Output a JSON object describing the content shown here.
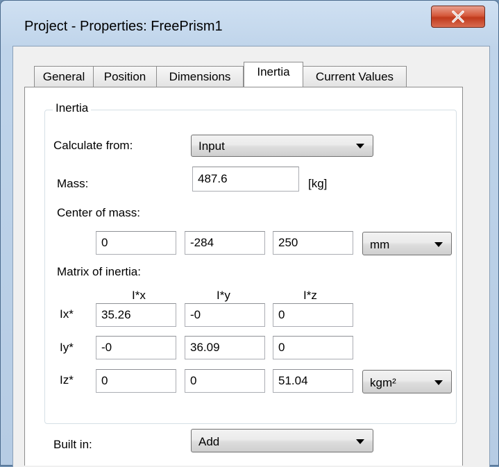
{
  "window": {
    "title": "Project - Properties: FreePrism1",
    "close_icon": "close-x-icon",
    "close_color": "#c7432a"
  },
  "tabs": [
    {
      "label": "General",
      "active": false
    },
    {
      "label": "Position",
      "active": false
    },
    {
      "label": "Dimensions",
      "active": false
    },
    {
      "label": "Inertia",
      "active": true
    },
    {
      "label": "Current Values",
      "active": false
    }
  ],
  "inertia": {
    "group_title": "Inertia",
    "calculate_from": {
      "label": "Calculate from:",
      "value": "Input"
    },
    "mass": {
      "label": "Mass:",
      "value": "487.6",
      "unit": "[kg]"
    },
    "center_of_mass": {
      "label": "Center of mass:",
      "x": "0",
      "y": "-284",
      "z": "250",
      "unit": "mm"
    },
    "matrix": {
      "label": "Matrix of inertia:",
      "col_headers": [
        "I*x",
        "I*y",
        "I*z"
      ],
      "row_labels": [
        "Ix*",
        "Iy*",
        "Iz*"
      ],
      "rows": [
        [
          "35.26",
          "-0",
          "0"
        ],
        [
          "-0",
          "36.09",
          "0"
        ],
        [
          "0",
          "0",
          "51.04"
        ]
      ],
      "unit": "kgm²"
    }
  },
  "built_in": {
    "label": "Built in:",
    "value": "Add"
  }
}
